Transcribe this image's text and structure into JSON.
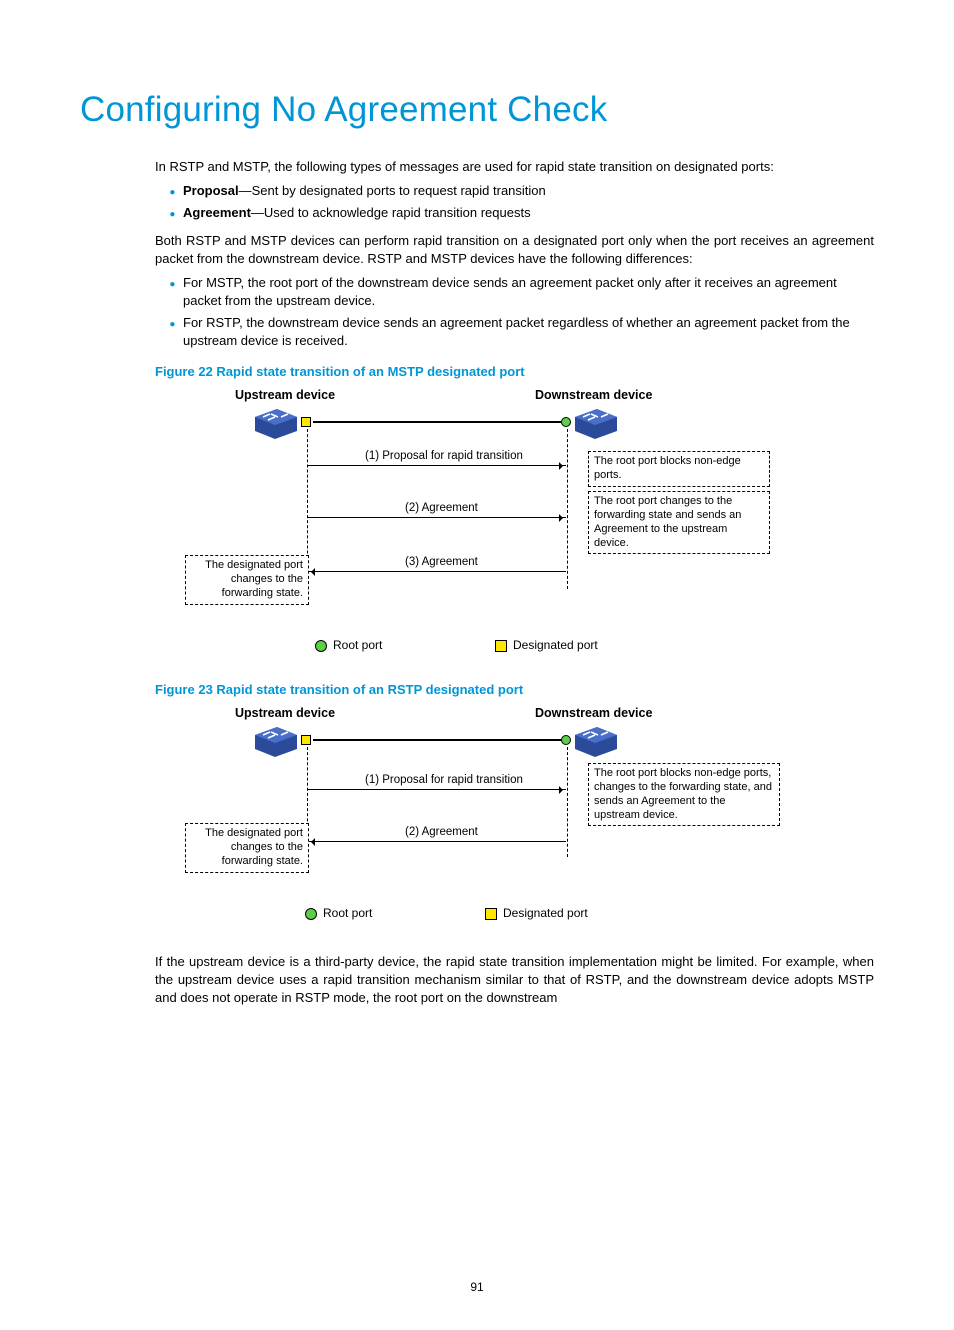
{
  "title": "Configuring No Agreement Check",
  "intro": "In RSTP and MSTP, the following types of messages are used for rapid state transition on designated ports:",
  "bullets1": [
    {
      "term": "Proposal",
      "desc": "—Sent by designated ports to request rapid transition"
    },
    {
      "term": "Agreement",
      "desc": "—Used to acknowledge rapid transition requests"
    }
  ],
  "para2": "Both RSTP and MSTP devices can perform rapid transition on a designated port only when the port receives an agreement packet from the downstream device. RSTP and MSTP devices have the following differences:",
  "bullets2": [
    "For MSTP, the root port of the downstream device sends an agreement packet only after it receives an agreement packet from the upstream device.",
    "For RSTP, the downstream device sends an agreement packet regardless of whether an agreement packet from the upstream device is received."
  ],
  "fig22_caption": "Figure 22 Rapid state transition of an MSTP designated port",
  "fig22": {
    "upstream": "Upstream device",
    "downstream": "Downstream device",
    "msg1": "(1) Proposal for rapid transition",
    "msg2": "(2) Agreement",
    "msg3": "(3) Agreement",
    "note1": "The root port blocks non-edge ports.",
    "note2": "The root port changes to the forwarding state and sends an Agreement to the upstream device.",
    "note3": "The designated port changes to the forwarding state.",
    "root_port": "Root port",
    "designated_port": "Designated port"
  },
  "fig23_caption": "Figure 23 Rapid state transition of an RSTP designated port",
  "fig23": {
    "upstream": "Upstream device",
    "downstream": "Downstream device",
    "msg1": "(1) Proposal for rapid transition",
    "msg2": "(2) Agreement",
    "note1": "The root port blocks non-edge ports, changes to the forwarding state, and sends an Agreement to the upstream device.",
    "note2": "The designated port changes to the forwarding state.",
    "root_port": "Root port",
    "designated_port": "Designated port"
  },
  "closing": "If the upstream device is a third-party device, the rapid state transition implementation might be limited. For example, when the upstream device uses a rapid transition mechanism similar to that of RSTP, and the downstream device adopts MSTP and does not operate in RSTP mode, the root port on the downstream",
  "page_number": "91"
}
